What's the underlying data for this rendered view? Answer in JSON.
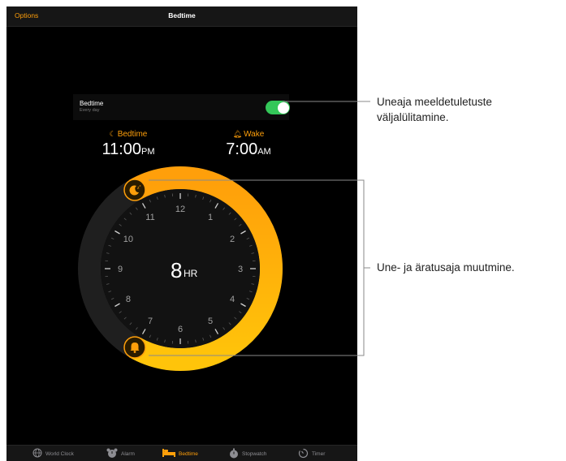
{
  "navbar": {
    "left_button": "Options",
    "title": "Bedtime"
  },
  "bedtime_row": {
    "title": "Bedtime",
    "subtitle": "Every day",
    "toggle_on": true
  },
  "bedtime_time": {
    "label": "Bedtime",
    "time": "11:00",
    "period": "PM"
  },
  "wake_time": {
    "label": "Wake",
    "time": "7:00",
    "period": "AM"
  },
  "clock": {
    "duration_number": "8",
    "duration_unit": "HR",
    "hours": [
      "12",
      "1",
      "2",
      "3",
      "4",
      "5",
      "6",
      "7",
      "8",
      "9",
      "10",
      "11"
    ],
    "start_icon": "moon-zzz-icon",
    "end_icon": "bell-icon"
  },
  "tabbar": {
    "tabs": [
      {
        "label": "World Clock",
        "icon": "globe-icon"
      },
      {
        "label": "Alarm",
        "icon": "alarm-clock-icon"
      },
      {
        "label": "Bedtime",
        "icon": "bed-icon",
        "active": true
      },
      {
        "label": "Stopwatch",
        "icon": "stopwatch-icon"
      },
      {
        "label": "Timer",
        "icon": "timer-icon"
      }
    ]
  },
  "callouts": [
    {
      "line1": "Uneaja meeldetuletuste",
      "line2": "väljalülitamine."
    },
    {
      "line1": "Une- ja äratusaja muutmine."
    }
  ],
  "colors": {
    "accent": "#ff9f0a",
    "ring_start": "#ffd60a",
    "ring_end": "#ff9500",
    "toggle_on": "#34c759",
    "background": "#000000",
    "callout_line": "#8a8a8a"
  }
}
